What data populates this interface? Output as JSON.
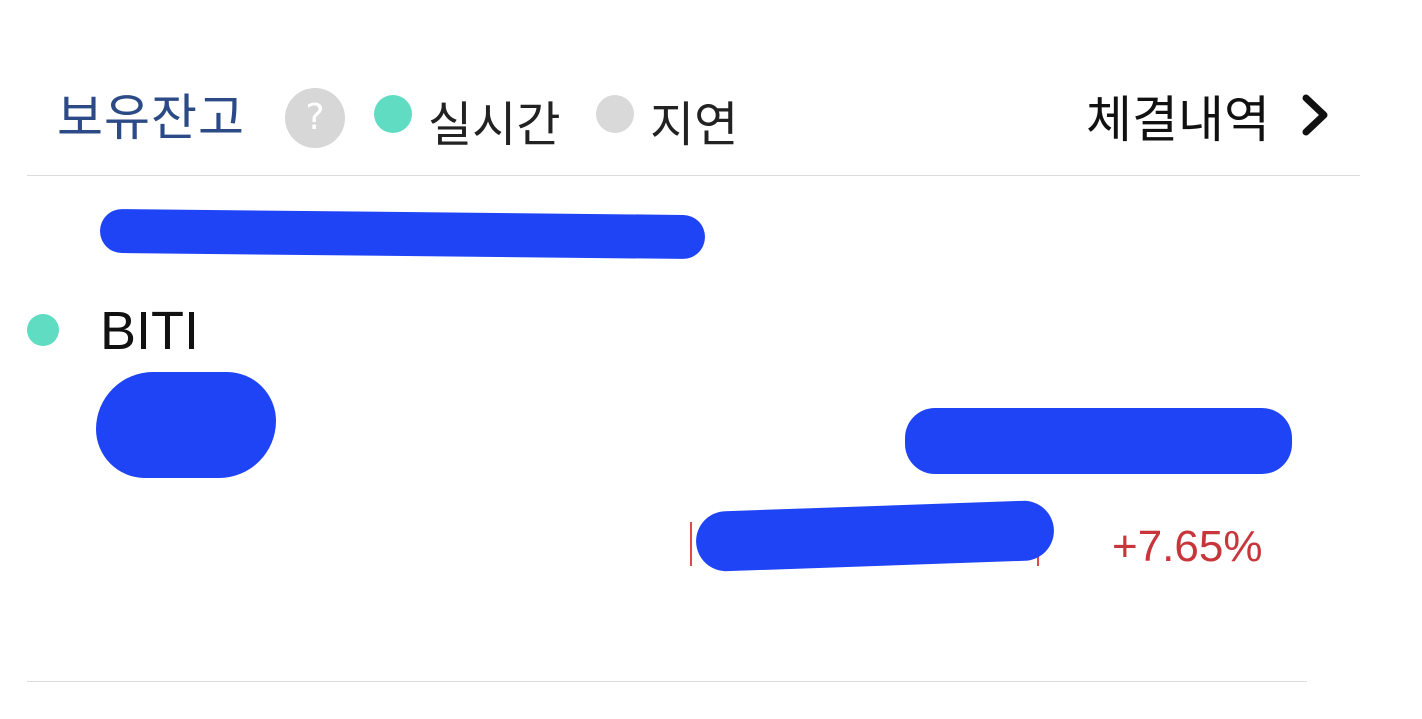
{
  "header": {
    "title": "보유잔고",
    "help_icon": "?",
    "legend": {
      "live_label": "실시간",
      "delay_label": "지연",
      "live_color": "#5fdcc1",
      "delay_color": "#d9d9d9"
    },
    "history_label": "체결내역",
    "history_icon": "chevron-right-icon"
  },
  "holding": {
    "stock_name": "BITI",
    "status_color": "#5fdcc1",
    "return_rate": "+7.65%",
    "return_color": "#c8353a"
  },
  "colors": {
    "title": "#2c4a86",
    "redaction": "#1f44f5"
  }
}
